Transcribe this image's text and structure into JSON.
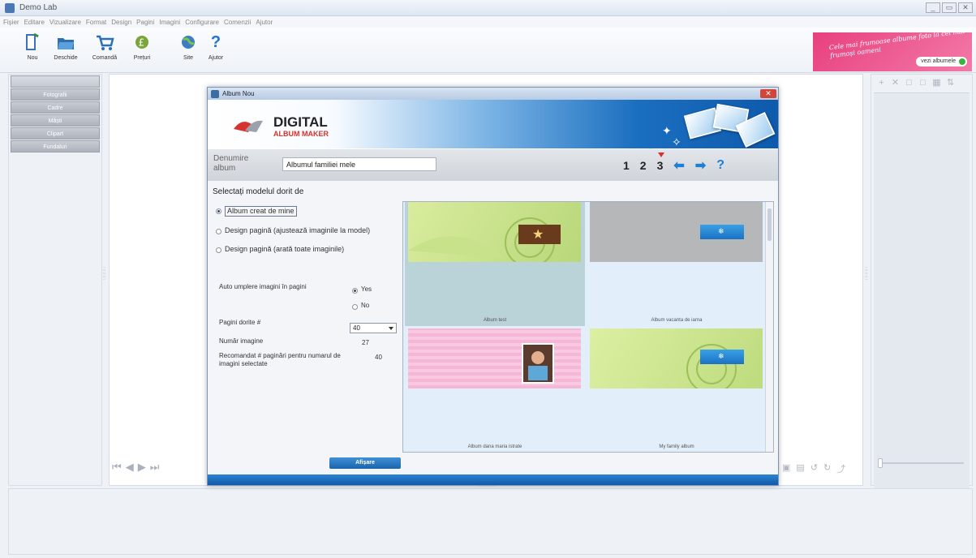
{
  "app": {
    "title": "Demo Lab",
    "window_buttons": [
      "_",
      "▭",
      "✕"
    ],
    "menu": [
      "Fișier",
      "Editare",
      "Vizualizare",
      "Format",
      "Design",
      "Pagini",
      "Imagini",
      "Configurare",
      "Comenzii",
      "Ajutor"
    ]
  },
  "toolbar": {
    "buttons": [
      {
        "label": "Nou",
        "icon": "new-document-icon"
      },
      {
        "label": "Deschide",
        "icon": "open-folder-icon"
      },
      {
        "label": "Comandă",
        "icon": "cart-icon"
      },
      {
        "label": "Prețuri",
        "icon": "price-icon"
      },
      {
        "label": "Site",
        "icon": "globe-icon"
      },
      {
        "label": "Ajutor",
        "icon": "help-icon"
      }
    ]
  },
  "promo": {
    "text": "Cele mai frumoase albume foto la cei mai frumoși oameni",
    "button_label": "vezi albumele"
  },
  "left_nav": {
    "items": [
      "",
      "Fotografii",
      "Cadre",
      "Măști",
      "Clipart",
      "Fundaluri"
    ]
  },
  "right_panel": {
    "tools": [
      "+",
      "✕",
      "□",
      "□",
      "▦",
      "⇅"
    ]
  },
  "nav_arrows": [
    "⏮",
    "◀",
    "▶",
    "⏭"
  ],
  "right_tools": [
    "▣",
    "▤",
    "↺",
    "↻",
    "⤴"
  ],
  "dialog": {
    "title": "Album Nou",
    "close_label": "✕",
    "logo_line1": "DIGITAL",
    "logo_line2": "ALBUM MAKER",
    "name_label": "Denumire album",
    "name_value": "Albumul familiei mele",
    "steps": [
      "1",
      "2",
      "3"
    ],
    "current_step": "3",
    "help_label": "?",
    "section_title": "Selectați modelul dorit de",
    "options": [
      {
        "label": "Album creat de mine",
        "selected": true
      },
      {
        "label": "Design pagină (ajustează imaginile la model)",
        "selected": false
      },
      {
        "label": "Design pagină (arată toate imaginile)",
        "selected": false
      }
    ],
    "auto_fill_label": "Auto umplere imagini în pagini",
    "auto_fill_yes": "Yes",
    "auto_fill_no": "No",
    "auto_fill_selected": "Yes",
    "pages_label": "Pagini dorite #",
    "pages_value": "40",
    "image_count_label": "Număr imagine",
    "image_count_value": "27",
    "recommended_label": "Recomandat # paginări pentru numarul de imagini selectate",
    "recommended_value": "40",
    "templates": [
      {
        "caption": "Album test"
      },
      {
        "caption": "Album vacanta de iarna"
      },
      {
        "caption": "Album dana maria istrate"
      },
      {
        "caption": "My family album"
      }
    ],
    "apply_label": "Afișare"
  },
  "colors": {
    "accent_blue": "#1b6fc0",
    "logo_red": "#d7322e",
    "promo_pink": "#e8407f",
    "selected_cell": "#b9d3d8"
  }
}
